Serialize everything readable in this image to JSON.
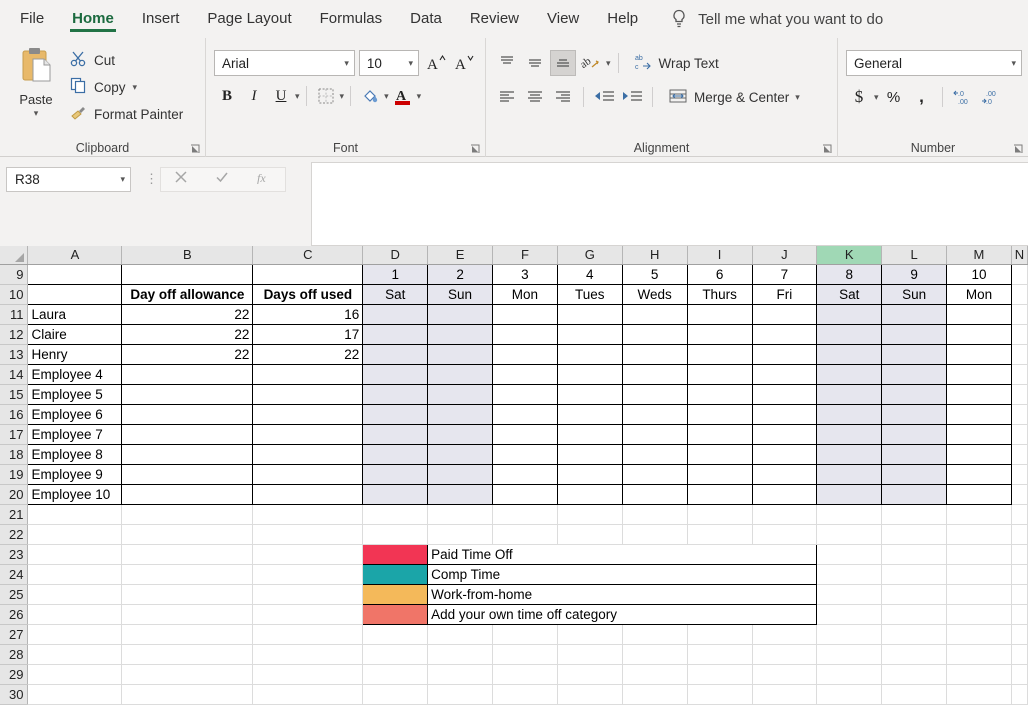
{
  "app": {
    "tabs": [
      {
        "label": "File",
        "active": false
      },
      {
        "label": "Home",
        "active": true
      },
      {
        "label": "Insert",
        "active": false
      },
      {
        "label": "Page Layout",
        "active": false
      },
      {
        "label": "Formulas",
        "active": false
      },
      {
        "label": "Data",
        "active": false
      },
      {
        "label": "Review",
        "active": false
      },
      {
        "label": "View",
        "active": false
      },
      {
        "label": "Help",
        "active": false
      }
    ],
    "tell_me": "Tell me what you want to do",
    "accent_color": "#217346"
  },
  "ribbon": {
    "clipboard": {
      "group_label": "Clipboard",
      "paste_label": "Paste",
      "cut_label": "Cut",
      "copy_label": "Copy",
      "format_painter_label": "Format Painter"
    },
    "font": {
      "group_label": "Font",
      "font_name": "Arial",
      "font_size": "10",
      "bold_label": "B",
      "italic_label": "I",
      "underline_label": "U"
    },
    "alignment": {
      "group_label": "Alignment",
      "wrap_text_label": "Wrap Text",
      "merge_center_label": "Merge & Center"
    },
    "number": {
      "group_label": "Number",
      "format_value": "General",
      "currency_label": "$",
      "percent_label": "%",
      "comma_label": ","
    }
  },
  "formula_bar": {
    "name_box_value": "R38",
    "formula_value": ""
  },
  "sheet": {
    "selected_column": "K",
    "columns": [
      {
        "letter": "A",
        "width": 94
      },
      {
        "letter": "B",
        "width": 131
      },
      {
        "letter": "C",
        "width": 110
      },
      {
        "letter": "D",
        "width": 65
      },
      {
        "letter": "E",
        "width": 65
      },
      {
        "letter": "F",
        "width": 65
      },
      {
        "letter": "G",
        "width": 65
      },
      {
        "letter": "H",
        "width": 65
      },
      {
        "letter": "I",
        "width": 65
      },
      {
        "letter": "J",
        "width": 65
      },
      {
        "letter": "K",
        "width": 65
      },
      {
        "letter": "L",
        "width": 65
      },
      {
        "letter": "M",
        "width": 65
      },
      {
        "letter": "N",
        "width": 16
      }
    ],
    "row_numbers": [
      9,
      10,
      11,
      12,
      13,
      14,
      15,
      16,
      17,
      18,
      19,
      20,
      21,
      22,
      23,
      24,
      25,
      26,
      27,
      28,
      29,
      30
    ],
    "weekend_columns": [
      "D",
      "E",
      "K",
      "L"
    ],
    "headers": {
      "day_off_allowance": "Day off allowance",
      "days_off_used": "Days off used"
    },
    "day_numbers": [
      "1",
      "2",
      "3",
      "4",
      "5",
      "6",
      "7",
      "8",
      "9",
      "10"
    ],
    "day_names": [
      "Sat",
      "Sun",
      "Mon",
      "Tues",
      "Weds",
      "Thurs",
      "Fri",
      "Sat",
      "Sun",
      "Mon"
    ],
    "employees": [
      {
        "name": "Laura",
        "allowance": "22",
        "used": "16"
      },
      {
        "name": "Claire",
        "allowance": "22",
        "used": "17"
      },
      {
        "name": "Henry",
        "allowance": "22",
        "used": "22"
      },
      {
        "name": "Employee 4",
        "allowance": "",
        "used": ""
      },
      {
        "name": "Employee 5",
        "allowance": "",
        "used": ""
      },
      {
        "name": "Employee 6",
        "allowance": "",
        "used": ""
      },
      {
        "name": "Employee 7",
        "allowance": "",
        "used": ""
      },
      {
        "name": "Employee 8",
        "allowance": "",
        "used": ""
      },
      {
        "name": "Employee 9",
        "allowance": "",
        "used": ""
      },
      {
        "name": "Employee 10",
        "allowance": "",
        "used": ""
      }
    ],
    "legend": [
      {
        "label": "Paid Time Off",
        "color": "#F23554"
      },
      {
        "label": "Comp Time",
        "color": "#1BA5A8"
      },
      {
        "label": "Work-from-home",
        "color": "#F4B95A"
      },
      {
        "label": "Add your own time off category",
        "color": "#F07568"
      }
    ]
  }
}
